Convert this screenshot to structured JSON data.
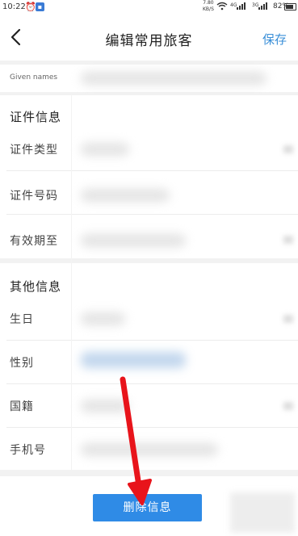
{
  "status_bar": {
    "time": "10:22",
    "net_speed_value": "7.80",
    "net_speed_unit": "KB/S",
    "signal1": "4G",
    "signal2": "3G",
    "battery": "82%"
  },
  "header": {
    "title": "编辑常用旅客",
    "save_label": "保存"
  },
  "top_row": {
    "label": "Given names"
  },
  "id_section": {
    "title": "证件信息",
    "rows": [
      {
        "label": "证件类型"
      },
      {
        "label": "证件号码"
      },
      {
        "label": "有效期至"
      }
    ]
  },
  "other_section": {
    "title": "其他信息",
    "rows": [
      {
        "label": "生日"
      },
      {
        "label": "性别"
      },
      {
        "label": "国籍"
      },
      {
        "label": "手机号"
      }
    ]
  },
  "footer": {
    "delete_label": "删除信息"
  },
  "colors": {
    "accent": "#3a8fd8",
    "button": "#2f8be6",
    "arrow": "#e8141b"
  }
}
